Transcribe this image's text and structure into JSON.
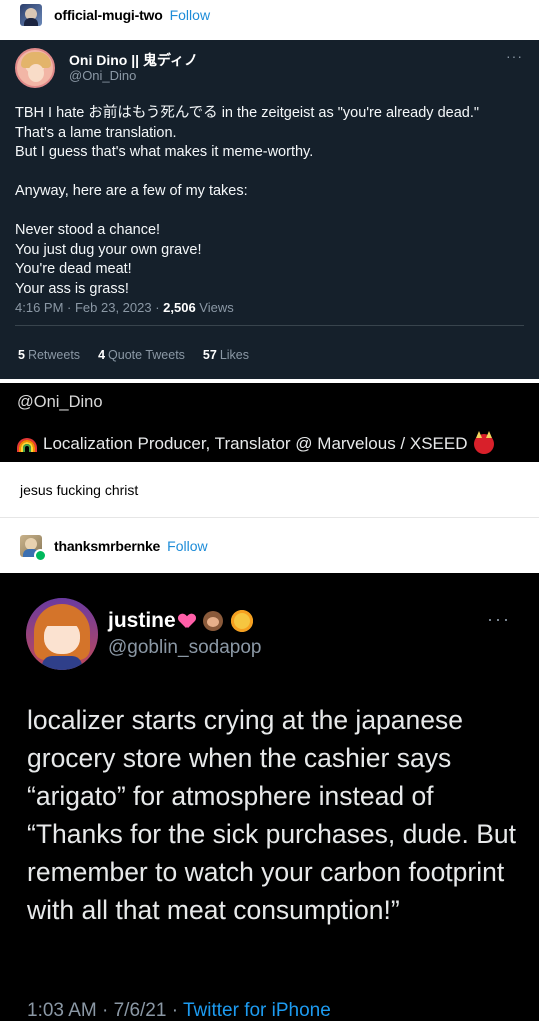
{
  "post1": {
    "blog_name": "official-mugi-two",
    "follow_label": "Follow"
  },
  "tweet1": {
    "name": "Oni Dino || 鬼ディノ",
    "handle": "@Oni_Dino",
    "more": "···",
    "body": "TBH I hate お前はもう死んでる in the zeitgeist as \"you're already dead.\"\nThat's a lame translation.\nBut I guess that's what makes it meme-worthy.\n\nAnyway, here are a few of my takes:\n\nNever stood a chance!\nYou just dug your own grave!\nYou're dead meat!\nYour ass is grass!",
    "time_date": "4:16 PM · Feb 23, 2023 · ",
    "views_count": "2,506",
    "views_label": " Views",
    "retweets_count": "5",
    "retweets_label": "Retweets",
    "quotes_count": "4",
    "quotes_label": "Quote Tweets",
    "likes_count": "57",
    "likes_label": "Likes"
  },
  "profile": {
    "handle": "@Oni_Dino",
    "bio": "Localization Producer, Translator @ Marvelous / XSEED"
  },
  "caption": "jesus fucking christ",
  "post2": {
    "blog_name": "thanksmrbernke",
    "follow_label": "Follow"
  },
  "tweet2": {
    "name": "justine",
    "handle": "@goblin_sodapop",
    "more": "···",
    "body": "localizer starts crying at the japanese grocery store when the cashier says “arigato” for atmosphere instead of “Thanks for the sick purchases, dude. But remember to watch your carbon footprint with all that meat consumption!”",
    "time_date": "1:03 AM · 7/6/21 · ",
    "source": "Twitter for iPhone"
  },
  "colors": {
    "follow": "#1d8cd8",
    "tweet1_bg": "#15202b",
    "tweet2_bg": "#000000",
    "twitter_blue": "#1d9bf0",
    "reblog_green": "#00b85c"
  }
}
